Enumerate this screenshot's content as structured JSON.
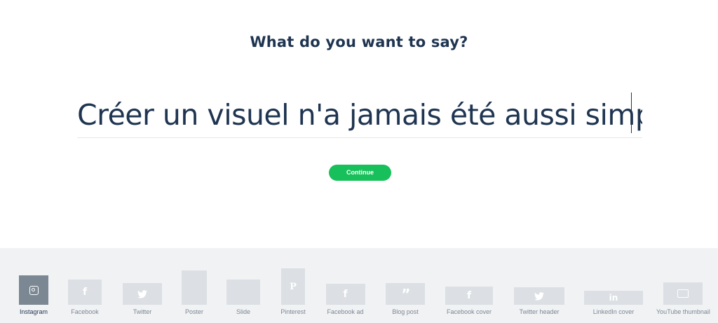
{
  "heading": "What do you want to say?",
  "text_input": {
    "value": "Créer un visuel n'a jamais été aussi simple !"
  },
  "continue_label": "Continue",
  "colors": {
    "text": "#1e3450",
    "accent_green": "#17c05a",
    "tray_bg": "#f1f2f4",
    "thumb": "#dcdfe3",
    "thumb_selected": "#7b8793"
  },
  "formats": [
    {
      "label": "Instagram",
      "icon": "instagram-icon",
      "selected": true
    },
    {
      "label": "Facebook",
      "icon": "facebook-icon"
    },
    {
      "label": "Twitter",
      "icon": "twitter-icon"
    },
    {
      "label": "Poster",
      "icon": ""
    },
    {
      "label": "Slide",
      "icon": ""
    },
    {
      "label": "Pinterest",
      "icon": "pinterest-icon"
    },
    {
      "label": "Facebook ad",
      "icon": "facebook-icon"
    },
    {
      "label": "Blog post",
      "icon": "quote-icon"
    },
    {
      "label": "Facebook cover",
      "icon": "facebook-icon"
    },
    {
      "label": "Twitter header",
      "icon": "twitter-icon"
    },
    {
      "label": "LinkedIn cover",
      "icon": "linkedin-icon"
    },
    {
      "label": "YouTube thumbnail",
      "icon": "youtube-icon"
    }
  ]
}
